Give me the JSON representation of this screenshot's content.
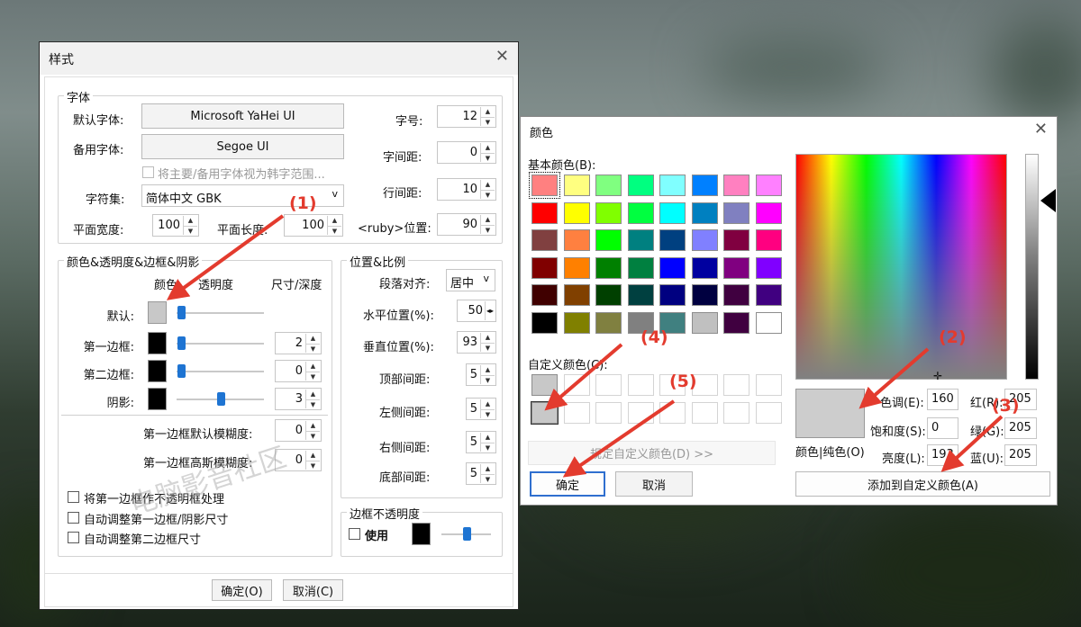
{
  "style_dialog": {
    "title": "样式",
    "font_group": {
      "legend": "字体",
      "default_font_label": "默认字体:",
      "default_font": "Microsoft YaHei UI",
      "alt_font_label": "备用字体:",
      "alt_font": "Segoe UI",
      "korean_check": "将主要/备用字体视为韩字范围...",
      "charset_label": "字符集:",
      "charset": "简体中文 GBK",
      "width_label": "平面宽度:",
      "width": "100",
      "length_label": "平面长度:",
      "length": "100",
      "size_label": "字号:",
      "size": "12",
      "spacing_label": "字间距:",
      "spacing": "0",
      "line_label": "行间距:",
      "line": "10",
      "ruby_label": "<ruby>位置:",
      "ruby": "90"
    },
    "color_group": {
      "legend": "颜色&透明度&边框&阴影",
      "col_color": "颜色",
      "col_opacity": "透明度",
      "col_size": "尺寸/深度",
      "rows": [
        {
          "label": "默认:",
          "color": "#c8c8c8",
          "opacity": 0.05,
          "size": ""
        },
        {
          "label": "第一边框:",
          "color": "#000000",
          "opacity": 0.05,
          "size": "2"
        },
        {
          "label": "第二边框:",
          "color": "#000000",
          "opacity": 0.05,
          "size": "0"
        },
        {
          "label": "阴影:",
          "color": "#000000",
          "opacity": 0.5,
          "size": "3"
        }
      ],
      "blur1_label": "第一边框默认模糊度:",
      "blur1": "0",
      "blur2_label": "第一边框高斯模糊度:",
      "blur2": "0",
      "opt1": "将第一边框作不透明框处理",
      "opt2": "自动调整第一边框/阴影尺寸",
      "opt3": "自动调整第二边框尺寸"
    },
    "position_group": {
      "legend": "位置&比例",
      "align_label": "段落对齐:",
      "align": "居中",
      "hpos_label": "水平位置(%):",
      "hpos": "50",
      "vpos_label": "垂直位置(%):",
      "vpos": "93",
      "top_label": "顶部间距:",
      "top": "5",
      "left_label": "左侧间距:",
      "left": "5",
      "right_label": "右侧间距:",
      "right": "5",
      "bottom_label": "底部间距:",
      "bottom": "5"
    },
    "border_opacity": {
      "legend": "边框不透明度",
      "use_label": "使用",
      "level": 0.5
    },
    "ok": "确定(O)",
    "cancel": "取消(C)"
  },
  "color_dialog": {
    "title": "颜色",
    "basic_label": "基本颜色(B):",
    "basic_colors": [
      "#ff8080",
      "#ffff80",
      "#80ff80",
      "#00ff80",
      "#80ffff",
      "#0080ff",
      "#ff80c0",
      "#ff80ff",
      "#ff0000",
      "#ffff00",
      "#80ff00",
      "#00ff40",
      "#00ffff",
      "#0080c0",
      "#8080c0",
      "#ff00ff",
      "#804040",
      "#ff8040",
      "#00ff00",
      "#008080",
      "#004080",
      "#8080ff",
      "#800040",
      "#ff0080",
      "#800000",
      "#ff8000",
      "#008000",
      "#008040",
      "#0000ff",
      "#0000a0",
      "#800080",
      "#8000ff",
      "#400000",
      "#804000",
      "#004000",
      "#004040",
      "#000080",
      "#000040",
      "#400040",
      "#400080",
      "#000000",
      "#808000",
      "#808040",
      "#808080",
      "#408080",
      "#c0c0c0",
      "#400040",
      "#ffffff"
    ],
    "custom_label": "自定义颜色(C):",
    "custom_colors": [
      "#c8c8c8",
      "",
      "",
      "",
      "",
      "",
      "",
      "",
      "#c8c8c8",
      "",
      "",
      "",
      "",
      "",
      "",
      ""
    ],
    "define_btn": "规定自定义颜色(D) >>",
    "ok": "确定",
    "cancel": "取消",
    "preview_color": "#cdcdcd",
    "preview_label": "颜色|纯色(O)",
    "hue_label": "色调(E):",
    "hue": "160",
    "sat_label": "饱和度(S):",
    "sat": "0",
    "lum_label": "亮度(L):",
    "lum": "193",
    "red_label": "红(R):",
    "red": "205",
    "green_label": "绿(G):",
    "green": "205",
    "blue_label": "蓝(U):",
    "blue": "205",
    "add_custom": "添加到自定义颜色(A)"
  },
  "annotations": {
    "a1": "(1)",
    "a2": "(2)",
    "a3": "(3)",
    "a4": "(4)",
    "a5": "(5)",
    "color": "#e33b2e"
  },
  "watermark": "电脑影音社区"
}
